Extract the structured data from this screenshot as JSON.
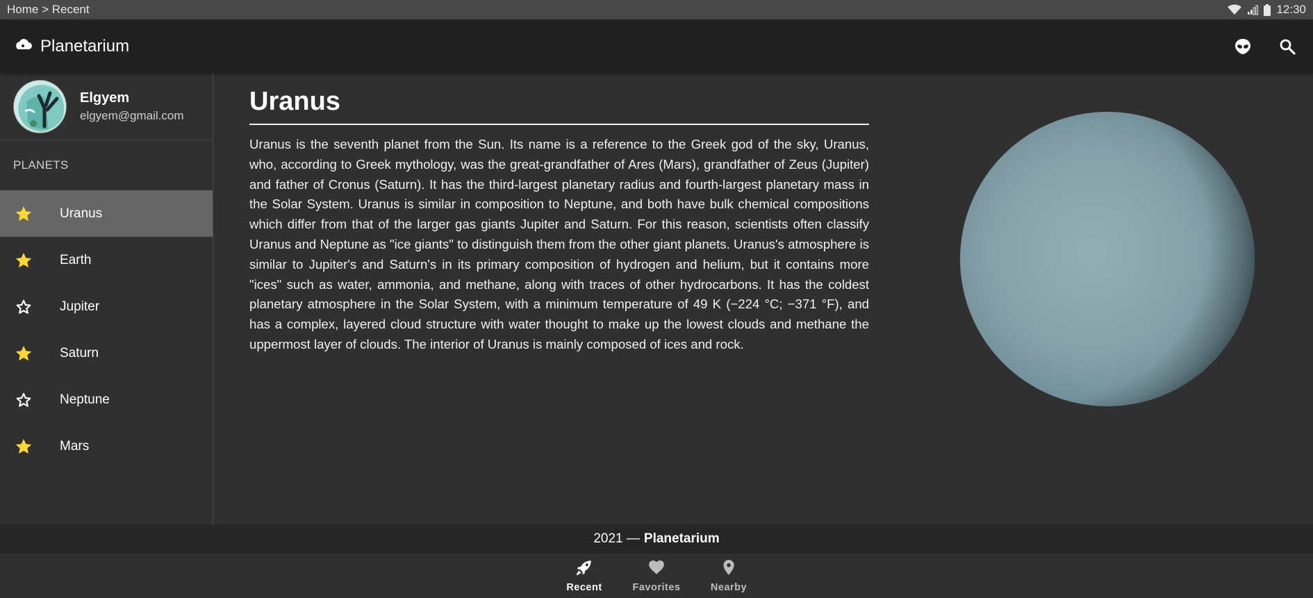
{
  "status_bar": {
    "breadcrumb": "Home > Recent",
    "time": "12:30"
  },
  "app_bar": {
    "title": "Planetarium",
    "icons": [
      "cloud-icon",
      "alien-icon",
      "search-icon"
    ]
  },
  "profile": {
    "name": "Elgyem",
    "email": "elgyem@gmail.com"
  },
  "sidebar": {
    "section_label": "PLANETS",
    "items": [
      {
        "label": "Uranus",
        "favorite": true,
        "active": true
      },
      {
        "label": "Earth",
        "favorite": true,
        "active": false
      },
      {
        "label": "Jupiter",
        "favorite": false,
        "active": false
      },
      {
        "label": "Saturn",
        "favorite": true,
        "active": false
      },
      {
        "label": "Neptune",
        "favorite": false,
        "active": false
      },
      {
        "label": "Mars",
        "favorite": true,
        "active": false
      }
    ]
  },
  "article": {
    "title": "Uranus",
    "body": "Uranus is the seventh planet from the Sun. Its name is a reference to the Greek god of the sky, Uranus, who, according to Greek mythology, was the great-grandfather of Ares (Mars), grandfather of Zeus (Jupiter) and father of Cronus (Saturn). It has the third-largest planetary radius and fourth-largest planetary mass in the Solar System. Uranus is similar in composition to Neptune, and both have bulk chemical compositions which differ from that of the larger gas giants Jupiter and Saturn. For this reason, scientists often classify Uranus and Neptune as \"ice giants\" to distinguish them from the other giant planets. Uranus's atmosphere is similar to Jupiter's and Saturn's in its primary composition of hydrogen and helium, but it contains more \"ices\" such as water, ammonia, and methane, along with traces of other hydrocarbons. It has the coldest planetary atmosphere in the Solar System, with a minimum temperature of 49 K (−224 °C; −371 °F), and has a complex, layered cloud structure with water thought to make up the lowest clouds and methane the uppermost layer of clouds. The interior of Uranus is mainly composed of ices and rock."
  },
  "footer": {
    "year": "2021 —",
    "brand": "Planetarium"
  },
  "bottom_nav": [
    {
      "label": "Recent",
      "icon": "rocket-icon",
      "active": true
    },
    {
      "label": "Favorites",
      "icon": "heart-icon",
      "active": false
    },
    {
      "label": "Nearby",
      "icon": "location-pin-icon",
      "active": false
    }
  ],
  "colors": {
    "star_filled": "#FDD835",
    "accent": "#ffffff",
    "active_item_bg": "#666666"
  }
}
